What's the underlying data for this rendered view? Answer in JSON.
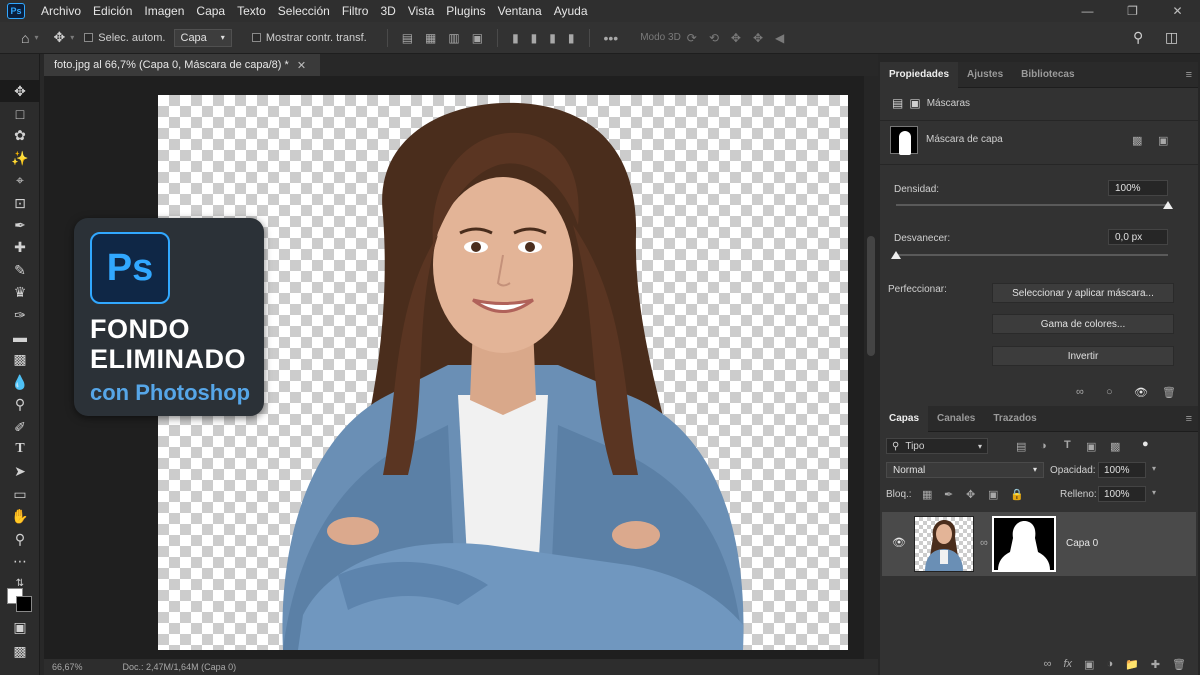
{
  "menu": {
    "logo": "Ps",
    "items": [
      "Archivo",
      "Edición",
      "Imagen",
      "Capa",
      "Texto",
      "Selección",
      "Filtro",
      "3D",
      "Vista",
      "Plugins",
      "Ventana",
      "Ayuda"
    ]
  },
  "options": {
    "auto_select_label": "Selec. autom.",
    "auto_select_value": "Capa",
    "transform_label": "Mostrar contr. transf.",
    "mode_3d_label": "Modo 3D"
  },
  "document": {
    "tab_title": "foto.jpg al 66,7% (Capa 0, Máscara de capa/8) *",
    "zoom_status": "66,67%",
    "doc_status": "Doc.: 2,47M/1,64M (Capa 0)"
  },
  "overlay": {
    "logo": "Ps",
    "line1": "FONDO",
    "line2": "ELIMINADO",
    "line3": "con Photoshop",
    "brand_color": "#31a8ff"
  },
  "properties": {
    "tabs": [
      "Propiedades",
      "Ajustes",
      "Bibliotecas"
    ],
    "section": "Máscaras",
    "mask_type": "Máscara de capa",
    "density_label": "Densidad:",
    "density_value": "100%",
    "density_fraction": 1.0,
    "feather_label": "Desvanecer:",
    "feather_value": "0,0 px",
    "feather_fraction": 0.0,
    "refine_label": "Perfeccionar:",
    "btn_select_mask": "Seleccionar y aplicar máscara...",
    "btn_color_range": "Gama de colores...",
    "btn_invert": "Invertir"
  },
  "layers": {
    "tabs": [
      "Capas",
      "Canales",
      "Trazados"
    ],
    "filter_kind": "Tipo",
    "blend_mode": "Normal",
    "opacity_label": "Opacidad:",
    "opacity_value": "100%",
    "lock_label": "Bloq.:",
    "fill_label": "Relleno:",
    "fill_value": "100%",
    "layer_name": "Capa 0"
  },
  "icons": [
    "home-icon",
    "move-icon",
    "marquee-icon",
    "lasso-icon",
    "quick-select-icon",
    "crop-icon",
    "frame-icon",
    "eyedropper-icon",
    "healing-icon",
    "brush-icon",
    "clone-stamp-icon",
    "history-brush-icon",
    "eraser-icon",
    "gradient-icon",
    "blur-icon",
    "dodge-icon",
    "pen-icon",
    "type-icon",
    "path-select-icon",
    "rectangle-icon",
    "hand-icon",
    "zoom-icon",
    "eye-icon",
    "search-icon",
    "workspace-icon"
  ]
}
